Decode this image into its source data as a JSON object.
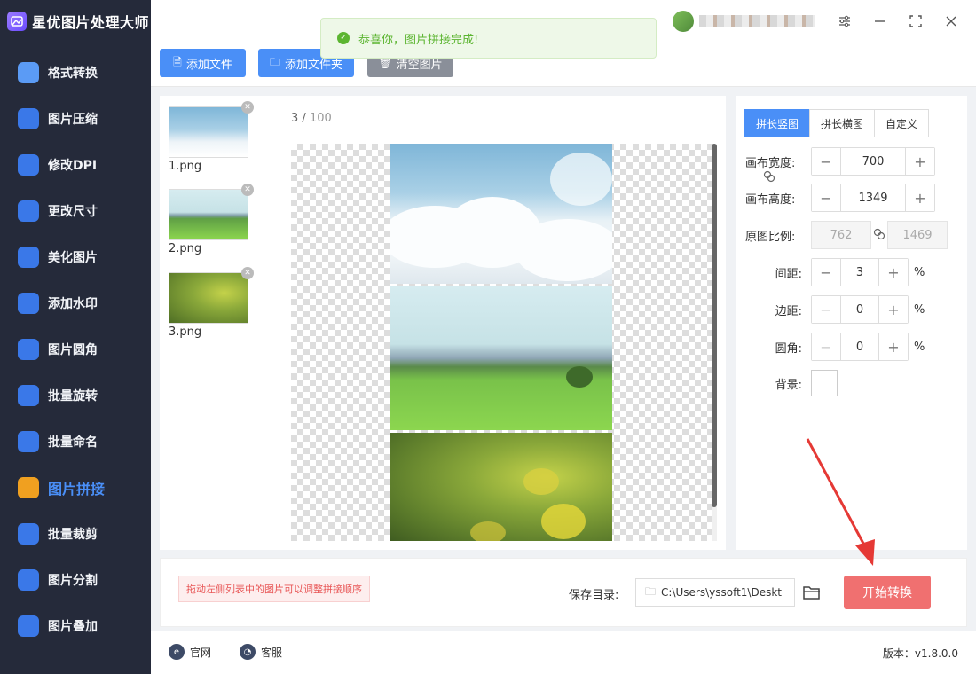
{
  "app": {
    "title": "星优图片处理大师"
  },
  "sidebar": {
    "items": [
      {
        "label": "格式转换",
        "icon": "image-convert-icon",
        "color": "#5b9bf5"
      },
      {
        "label": "图片压缩",
        "icon": "compress-icon",
        "color": "#3a78e8"
      },
      {
        "label": "修改DPI",
        "icon": "dpi-icon",
        "color": "#3a78e8"
      },
      {
        "label": "更改尺寸",
        "icon": "resize-icon",
        "color": "#3a78e8"
      },
      {
        "label": "美化图片",
        "icon": "beautify-icon",
        "color": "#3a78e8"
      },
      {
        "label": "添加水印",
        "icon": "watermark-icon",
        "color": "#3a78e8"
      },
      {
        "label": "图片圆角",
        "icon": "rounded-corner-icon",
        "color": "#3a78e8"
      },
      {
        "label": "批量旋转",
        "icon": "rotate-icon",
        "color": "#3a78e8"
      },
      {
        "label": "批量命名",
        "icon": "rename-icon",
        "color": "#3a78e8"
      },
      {
        "label": "图片拼接",
        "icon": "stitch-icon",
        "color": "#f0a020",
        "active": true
      },
      {
        "label": "批量裁剪",
        "icon": "crop-icon",
        "color": "#3a78e8"
      },
      {
        "label": "图片分割",
        "icon": "split-icon",
        "color": "#3a78e8"
      },
      {
        "label": "图片叠加",
        "icon": "overlay-icon",
        "color": "#3a78e8"
      }
    ]
  },
  "toolbar": {
    "add_file": "添加文件",
    "add_folder": "添加文件夹",
    "clear": "清空图片"
  },
  "toast": {
    "message": "恭喜你，图片拼接完成!"
  },
  "files": {
    "count": "3",
    "max": "100",
    "items": [
      {
        "name": "1.png"
      },
      {
        "name": "2.png"
      },
      {
        "name": "3.png"
      }
    ]
  },
  "settings": {
    "tabs": [
      "拼长竖图",
      "拼长横图",
      "自定义"
    ],
    "active_tab": 0,
    "canvas_width_label": "画布宽度:",
    "canvas_width": "700",
    "canvas_height_label": "画布高度:",
    "canvas_height": "1349",
    "ratio_label": "原图比例:",
    "ratio_w": "762",
    "ratio_h": "1469",
    "spacing_label": "间距:",
    "spacing": "3",
    "margin_label": "边距:",
    "margin": "0",
    "radius_label": "圆角:",
    "radius": "0",
    "background_label": "背景:",
    "percent": "%",
    "minus": "−",
    "plus": "+"
  },
  "action": {
    "hint": "拖动左侧列表中的图片可以调整拼接顺序",
    "save_label": "保存目录:",
    "save_path": "C:\\Users\\yssoft1\\Deskt",
    "start": "开始转换"
  },
  "footer": {
    "website": "官网",
    "support": "客服",
    "version": "版本：v1.8.0.0"
  },
  "colors": {
    "primary": "#4a8ff7",
    "sidebar_bg": "#252a3a",
    "start_button": "#f07070",
    "success": "#5cb531",
    "disabled_button": "#8a8f99"
  }
}
